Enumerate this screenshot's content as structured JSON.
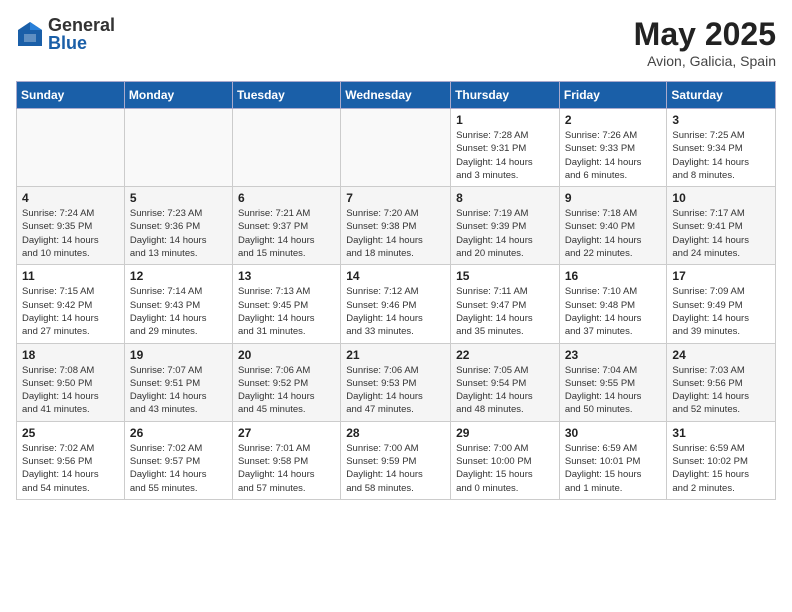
{
  "header": {
    "logo_general": "General",
    "logo_blue": "Blue",
    "month_year": "May 2025",
    "location": "Avion, Galicia, Spain"
  },
  "days_of_week": [
    "Sunday",
    "Monday",
    "Tuesday",
    "Wednesday",
    "Thursday",
    "Friday",
    "Saturday"
  ],
  "weeks": [
    [
      {
        "day": "",
        "info": ""
      },
      {
        "day": "",
        "info": ""
      },
      {
        "day": "",
        "info": ""
      },
      {
        "day": "",
        "info": ""
      },
      {
        "day": "1",
        "info": "Sunrise: 7:28 AM\nSunset: 9:31 PM\nDaylight: 14 hours\nand 3 minutes."
      },
      {
        "day": "2",
        "info": "Sunrise: 7:26 AM\nSunset: 9:33 PM\nDaylight: 14 hours\nand 6 minutes."
      },
      {
        "day": "3",
        "info": "Sunrise: 7:25 AM\nSunset: 9:34 PM\nDaylight: 14 hours\nand 8 minutes."
      }
    ],
    [
      {
        "day": "4",
        "info": "Sunrise: 7:24 AM\nSunset: 9:35 PM\nDaylight: 14 hours\nand 10 minutes."
      },
      {
        "day": "5",
        "info": "Sunrise: 7:23 AM\nSunset: 9:36 PM\nDaylight: 14 hours\nand 13 minutes."
      },
      {
        "day": "6",
        "info": "Sunrise: 7:21 AM\nSunset: 9:37 PM\nDaylight: 14 hours\nand 15 minutes."
      },
      {
        "day": "7",
        "info": "Sunrise: 7:20 AM\nSunset: 9:38 PM\nDaylight: 14 hours\nand 18 minutes."
      },
      {
        "day": "8",
        "info": "Sunrise: 7:19 AM\nSunset: 9:39 PM\nDaylight: 14 hours\nand 20 minutes."
      },
      {
        "day": "9",
        "info": "Sunrise: 7:18 AM\nSunset: 9:40 PM\nDaylight: 14 hours\nand 22 minutes."
      },
      {
        "day": "10",
        "info": "Sunrise: 7:17 AM\nSunset: 9:41 PM\nDaylight: 14 hours\nand 24 minutes."
      }
    ],
    [
      {
        "day": "11",
        "info": "Sunrise: 7:15 AM\nSunset: 9:42 PM\nDaylight: 14 hours\nand 27 minutes."
      },
      {
        "day": "12",
        "info": "Sunrise: 7:14 AM\nSunset: 9:43 PM\nDaylight: 14 hours\nand 29 minutes."
      },
      {
        "day": "13",
        "info": "Sunrise: 7:13 AM\nSunset: 9:45 PM\nDaylight: 14 hours\nand 31 minutes."
      },
      {
        "day": "14",
        "info": "Sunrise: 7:12 AM\nSunset: 9:46 PM\nDaylight: 14 hours\nand 33 minutes."
      },
      {
        "day": "15",
        "info": "Sunrise: 7:11 AM\nSunset: 9:47 PM\nDaylight: 14 hours\nand 35 minutes."
      },
      {
        "day": "16",
        "info": "Sunrise: 7:10 AM\nSunset: 9:48 PM\nDaylight: 14 hours\nand 37 minutes."
      },
      {
        "day": "17",
        "info": "Sunrise: 7:09 AM\nSunset: 9:49 PM\nDaylight: 14 hours\nand 39 minutes."
      }
    ],
    [
      {
        "day": "18",
        "info": "Sunrise: 7:08 AM\nSunset: 9:50 PM\nDaylight: 14 hours\nand 41 minutes."
      },
      {
        "day": "19",
        "info": "Sunrise: 7:07 AM\nSunset: 9:51 PM\nDaylight: 14 hours\nand 43 minutes."
      },
      {
        "day": "20",
        "info": "Sunrise: 7:06 AM\nSunset: 9:52 PM\nDaylight: 14 hours\nand 45 minutes."
      },
      {
        "day": "21",
        "info": "Sunrise: 7:06 AM\nSunset: 9:53 PM\nDaylight: 14 hours\nand 47 minutes."
      },
      {
        "day": "22",
        "info": "Sunrise: 7:05 AM\nSunset: 9:54 PM\nDaylight: 14 hours\nand 48 minutes."
      },
      {
        "day": "23",
        "info": "Sunrise: 7:04 AM\nSunset: 9:55 PM\nDaylight: 14 hours\nand 50 minutes."
      },
      {
        "day": "24",
        "info": "Sunrise: 7:03 AM\nSunset: 9:56 PM\nDaylight: 14 hours\nand 52 minutes."
      }
    ],
    [
      {
        "day": "25",
        "info": "Sunrise: 7:02 AM\nSunset: 9:56 PM\nDaylight: 14 hours\nand 54 minutes."
      },
      {
        "day": "26",
        "info": "Sunrise: 7:02 AM\nSunset: 9:57 PM\nDaylight: 14 hours\nand 55 minutes."
      },
      {
        "day": "27",
        "info": "Sunrise: 7:01 AM\nSunset: 9:58 PM\nDaylight: 14 hours\nand 57 minutes."
      },
      {
        "day": "28",
        "info": "Sunrise: 7:00 AM\nSunset: 9:59 PM\nDaylight: 14 hours\nand 58 minutes."
      },
      {
        "day": "29",
        "info": "Sunrise: 7:00 AM\nSunset: 10:00 PM\nDaylight: 15 hours\nand 0 minutes."
      },
      {
        "day": "30",
        "info": "Sunrise: 6:59 AM\nSunset: 10:01 PM\nDaylight: 15 hours\nand 1 minute."
      },
      {
        "day": "31",
        "info": "Sunrise: 6:59 AM\nSunset: 10:02 PM\nDaylight: 15 hours\nand 2 minutes."
      }
    ]
  ]
}
